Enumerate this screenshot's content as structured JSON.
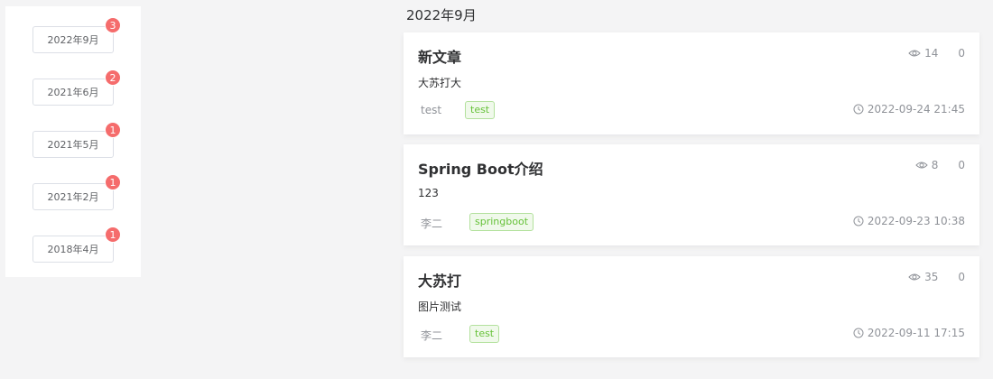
{
  "sidebar": {
    "months": [
      {
        "label": "2022年9月",
        "count": "3"
      },
      {
        "label": "2021年6月",
        "count": "2"
      },
      {
        "label": "2021年5月",
        "count": "1"
      },
      {
        "label": "2021年2月",
        "count": "1"
      },
      {
        "label": "2018年4月",
        "count": "1"
      }
    ]
  },
  "main": {
    "section_title": "2022年9月",
    "articles": [
      {
        "title": "新文章",
        "views": "14",
        "comments": "0",
        "summary": "大苏打大",
        "author": "test",
        "tag": "test",
        "date": "2022-09-24 21:45"
      },
      {
        "title": "Spring Boot介绍",
        "views": "8",
        "comments": "0",
        "summary": "123",
        "author": "李二",
        "tag": "springboot",
        "date": "2022-09-23 10:38"
      },
      {
        "title": "大苏打",
        "views": "35",
        "comments": "0",
        "summary": "图片测试",
        "author": "李二",
        "tag": "test",
        "date": "2022-09-11 17:15"
      }
    ]
  },
  "colors": {
    "badge": "#f56c6c",
    "tag_text": "#67c23a",
    "tag_bg": "#f0f9eb",
    "muted": "#909399"
  },
  "icons": {
    "views": "eye-icon",
    "date": "clock-icon"
  }
}
